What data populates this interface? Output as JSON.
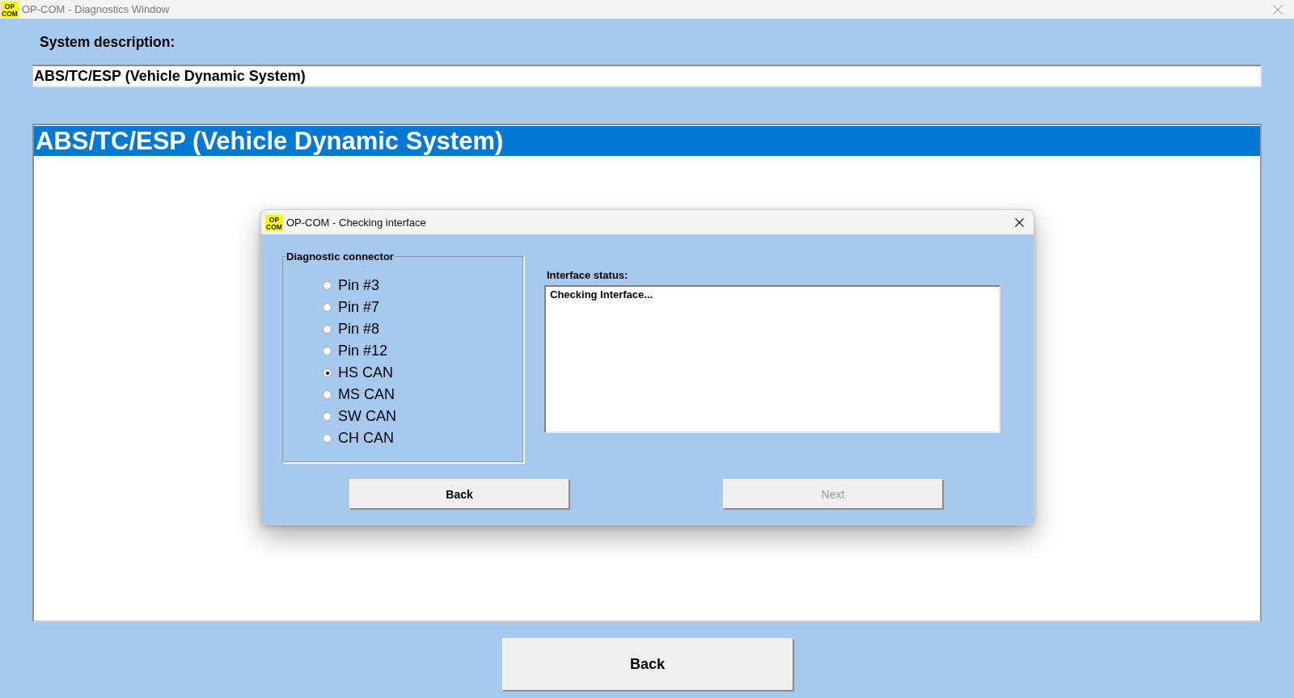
{
  "window": {
    "title": "OP-COM - Diagnostics Window",
    "logo_text": [
      "OP",
      "COM"
    ]
  },
  "system_description": {
    "label": "System description:",
    "value": "ABS/TC/ESP (Vehicle Dynamic System)"
  },
  "panel": {
    "header": "ABS/TC/ESP (Vehicle Dynamic System)"
  },
  "dialog": {
    "title": "OP-COM - Checking interface",
    "logo_text": [
      "OP",
      "COM"
    ],
    "connector_group": {
      "legend": "Diagnostic connector",
      "options": [
        {
          "label": "Pin #3",
          "selected": false
        },
        {
          "label": "Pin #7",
          "selected": false
        },
        {
          "label": "Pin #8",
          "selected": false
        },
        {
          "label": "Pin #12",
          "selected": false
        },
        {
          "label": "HS CAN",
          "selected": true
        },
        {
          "label": "MS CAN",
          "selected": false
        },
        {
          "label": "SW CAN",
          "selected": false
        },
        {
          "label": "CH CAN",
          "selected": false
        }
      ]
    },
    "interface_status": {
      "label": "Interface status:",
      "value": "Checking Interface..."
    },
    "buttons": [
      {
        "label": "Back",
        "disabled": false
      },
      {
        "label": "Next",
        "disabled": true
      }
    ]
  },
  "footer": {
    "buttons": [
      {
        "label": "Back",
        "disabled": false
      }
    ]
  }
}
